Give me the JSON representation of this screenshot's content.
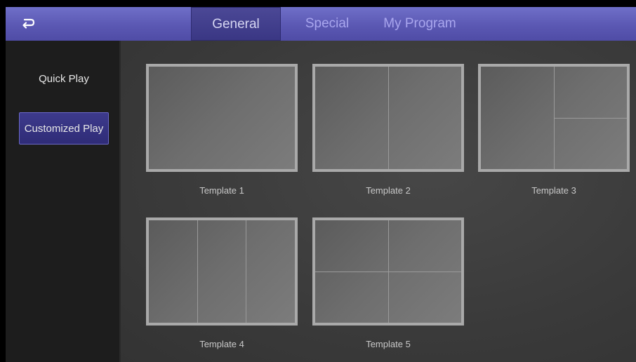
{
  "header": {
    "back_icon": "return-arrow-icon",
    "tabs": [
      {
        "label": "General",
        "active": true
      },
      {
        "label": "Special",
        "active": false
      },
      {
        "label": "My Program",
        "active": false
      }
    ]
  },
  "sidebar": {
    "items": [
      {
        "label": "Quick Play",
        "selected": false
      },
      {
        "label": "Customized Play",
        "selected": true
      }
    ]
  },
  "templates": [
    {
      "label": "Template 1",
      "layout": "single"
    },
    {
      "label": "Template 2",
      "layout": "two-vertical"
    },
    {
      "label": "Template 3",
      "layout": "one-left-two-right"
    },
    {
      "label": "Template 4",
      "layout": "three-vertical"
    },
    {
      "label": "Template 5",
      "layout": "four-grid"
    }
  ],
  "colors": {
    "accent": "#5b58b3",
    "active_tab": "#3a3784",
    "selected_item_border": "#6b68c8"
  }
}
